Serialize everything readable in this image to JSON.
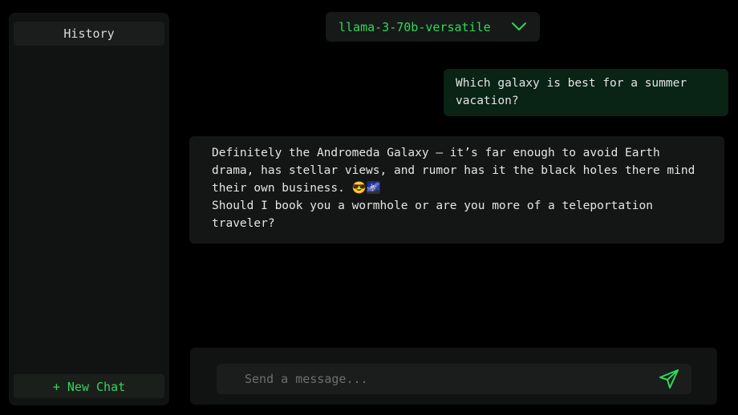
{
  "sidebar": {
    "history_label": "History",
    "new_chat_label": "+ New Chat"
  },
  "header": {
    "model_name": "llama-3-70b-versatile",
    "model_dropdown_icon": "chevron-down-icon"
  },
  "conversation": {
    "user_message": "Which galaxy is best for a summer vacation?",
    "assistant_message_line1": "Definitely the Andromeda Galaxy — it’s far enough to avoid Earth drama, has stellar views, and rumor has it the black holes there mind their own business. 😎🌌",
    "assistant_message_line2": "Should I book you a wormhole or are you more of a teleportation traveler?"
  },
  "composer": {
    "placeholder": "Send a message...",
    "send_icon": "send-icon"
  },
  "colors": {
    "accent": "#2fd95a",
    "background": "#000000",
    "panel": "#111312",
    "user_bubble": "#092315",
    "assistant_bubble": "#141615"
  }
}
